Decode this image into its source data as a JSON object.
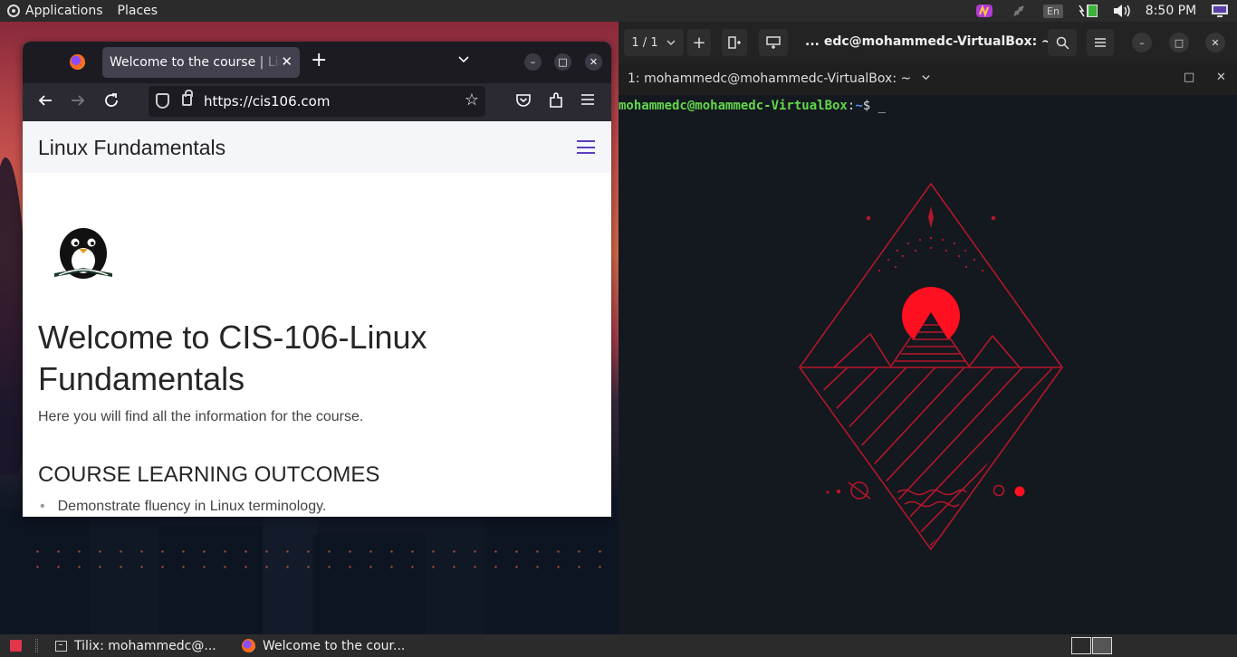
{
  "top_panel": {
    "applications": "Applications",
    "places": "Places",
    "keyboard_layout": "En",
    "clock": "8:50 PM"
  },
  "browser": {
    "tab_title": "Welcome to the course | Linux Fundamentals",
    "url_host": "https://cis106.com",
    "site_title": "Linux Fundamentals",
    "heading": "Welcome to CIS-106-Linux Fundamentals",
    "subtitle": "Here you will find all the information for the course.",
    "outcomes_heading": "COURSE LEARNING OUTCOMES",
    "outcomes": [
      "Demonstrate fluency in Linux terminology."
    ]
  },
  "terminal": {
    "session_counter": "1 / 1",
    "window_title": "... edc@mohammedc-VirtualBox: ~",
    "session_title": "1: mohammedc@mohammedc-VirtualBox: ~",
    "prompt_user_host": "mohammedc@mohammedc-VirtualBox",
    "prompt_colon": ":",
    "prompt_path": "~",
    "prompt_symbol": "$",
    "cursor": "_"
  },
  "taskbar": {
    "items": [
      {
        "label": "Tilix: mohammedc@...",
        "icon": "terminal-icon"
      },
      {
        "label": "Welcome to the cour...",
        "icon": "firefox-icon"
      }
    ]
  },
  "colors": {
    "prompt_user": "#62d84a",
    "prompt_path": "#5d8ef5",
    "art_red": "#e0192c"
  }
}
